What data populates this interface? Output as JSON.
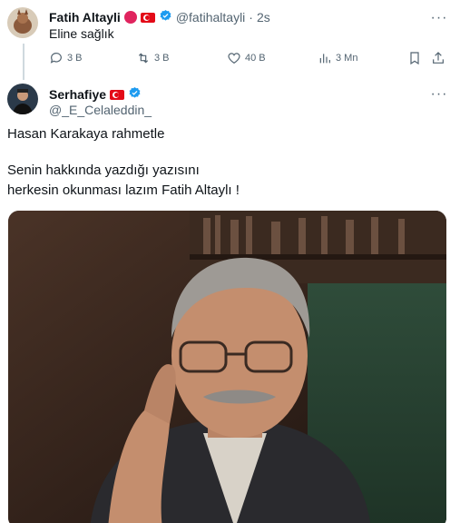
{
  "quoted_tweet": {
    "author_name": "Fatih Altayli",
    "handle": "@fatihaltayli",
    "separator": "·",
    "time": "2s",
    "text": "Eline sağlık",
    "actions": {
      "replies": "3 B",
      "retweets": "3 B",
      "likes": "40 B",
      "views": "3 Mn"
    }
  },
  "tweet": {
    "author_name": "Serhafiye",
    "handle": "@_E_Celaleddin_",
    "line1": "Hasan Karakaya rahmetle",
    "line2": "Senin hakkında yazdığı yazısını",
    "line3": "herkesin okunması lazım Fatih Altaylı !"
  },
  "icons": {
    "reply": "reply-icon",
    "retweet": "retweet-icon",
    "like": "heart-icon",
    "views": "views-icon",
    "bookmark": "bookmark-icon",
    "share": "share-icon",
    "more": "more-icon",
    "verified": "verified-badge-icon"
  },
  "colors": {
    "verified": "#1d9bf0",
    "flag_red": "#e30a17",
    "secondary_text": "#536471"
  }
}
